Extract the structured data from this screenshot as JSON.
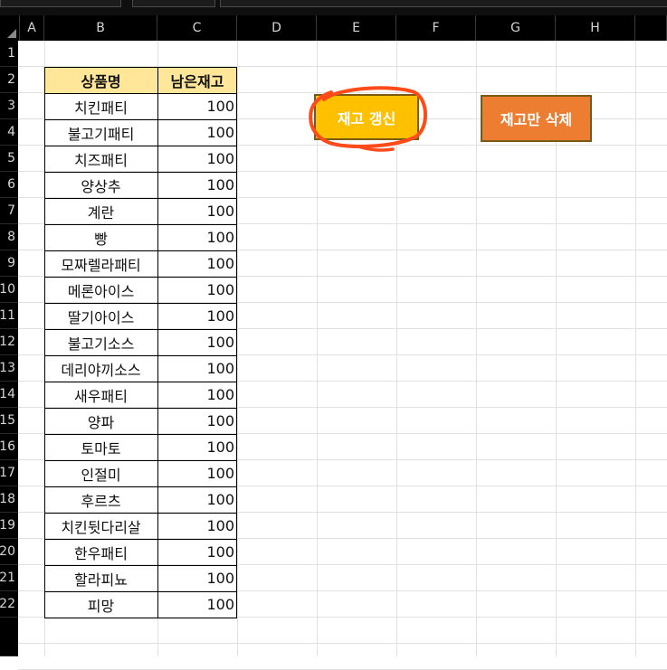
{
  "columns": [
    "A",
    "B",
    "C",
    "D",
    "E",
    "F",
    "G",
    "H"
  ],
  "rows": [
    "1",
    "2",
    "3",
    "4",
    "5",
    "6",
    "7",
    "8",
    "9",
    "10",
    "11",
    "12",
    "13",
    "14",
    "15",
    "16",
    "17",
    "18",
    "19",
    "20",
    "21",
    "22"
  ],
  "table": {
    "headers": [
      "상품명",
      "남은재고"
    ],
    "items": [
      {
        "name": "치킨패티",
        "qty": "100"
      },
      {
        "name": "불고기패티",
        "qty": "100"
      },
      {
        "name": "치즈패티",
        "qty": "100"
      },
      {
        "name": "양상추",
        "qty": "100"
      },
      {
        "name": "계란",
        "qty": "100"
      },
      {
        "name": "빵",
        "qty": "100"
      },
      {
        "name": "모짜렐라패티",
        "qty": "100"
      },
      {
        "name": "메론아이스",
        "qty": "100"
      },
      {
        "name": "딸기아이스",
        "qty": "100"
      },
      {
        "name": "불고기소스",
        "qty": "100"
      },
      {
        "name": "데리야끼소스",
        "qty": "100"
      },
      {
        "name": "새우패티",
        "qty": "100"
      },
      {
        "name": "양파",
        "qty": "100"
      },
      {
        "name": "토마토",
        "qty": "100"
      },
      {
        "name": "인절미",
        "qty": "100"
      },
      {
        "name": "후르츠",
        "qty": "100"
      },
      {
        "name": "치킨뒷다리살",
        "qty": "100"
      },
      {
        "name": "한우패티",
        "qty": "100"
      },
      {
        "name": "할라피뇨",
        "qty": "100"
      },
      {
        "name": "피망",
        "qty": "100"
      }
    ]
  },
  "buttons": {
    "update_label": "재고 갱신",
    "delete_label": "재고만 삭제"
  },
  "colors": {
    "header_fill": "#ffe699",
    "update_button": "#ffc000",
    "delete_button": "#ed7d31",
    "annotation": "#ff4a1a"
  }
}
